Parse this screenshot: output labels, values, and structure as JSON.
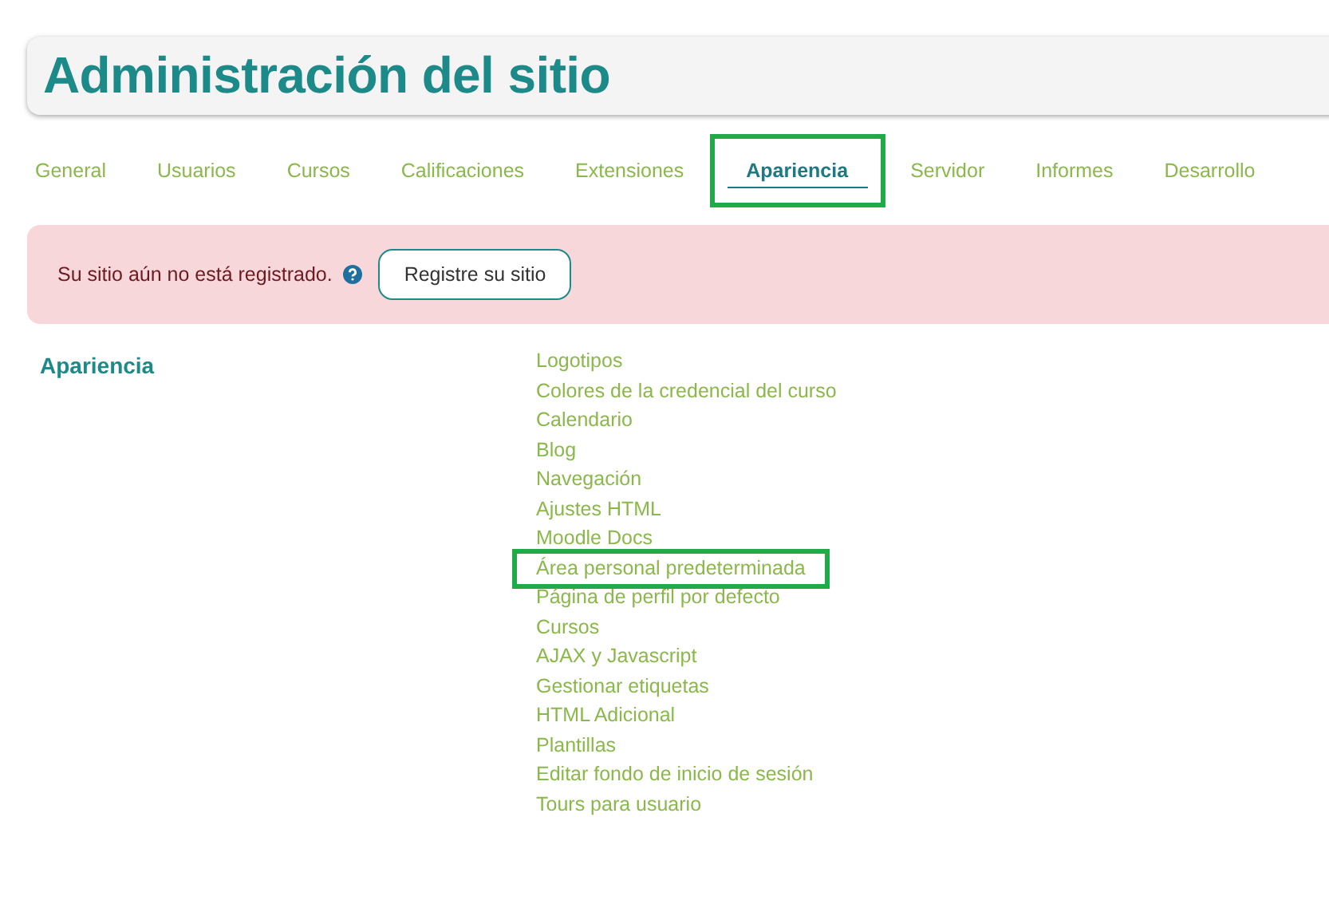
{
  "page_title": "Administración del sitio",
  "tabs": [
    {
      "label": "General",
      "selected": false,
      "highlighted": false
    },
    {
      "label": "Usuarios",
      "selected": false,
      "highlighted": false
    },
    {
      "label": "Cursos",
      "selected": false,
      "highlighted": false
    },
    {
      "label": "Calificaciones",
      "selected": false,
      "highlighted": false
    },
    {
      "label": "Extensiones",
      "selected": false,
      "highlighted": false
    },
    {
      "label": "Apariencia",
      "selected": true,
      "highlighted": true
    },
    {
      "label": "Servidor",
      "selected": false,
      "highlighted": false
    },
    {
      "label": "Informes",
      "selected": false,
      "highlighted": false
    },
    {
      "label": "Desarrollo",
      "selected": false,
      "highlighted": false
    }
  ],
  "alert": {
    "message": "Su sitio aún no está registrado.",
    "button": "Registre su sitio"
  },
  "section": {
    "heading": "Apariencia",
    "links": [
      {
        "label": "Logotipos",
        "highlighted": false
      },
      {
        "label": "Colores de la credencial del curso",
        "highlighted": false
      },
      {
        "label": "Calendario",
        "highlighted": false
      },
      {
        "label": "Blog",
        "highlighted": false
      },
      {
        "label": "Navegación",
        "highlighted": false
      },
      {
        "label": "Ajustes HTML",
        "highlighted": false
      },
      {
        "label": "Moodle Docs",
        "highlighted": false
      },
      {
        "label": "Área personal predeterminada",
        "highlighted": true
      },
      {
        "label": "Página de perfil por defecto",
        "highlighted": false
      },
      {
        "label": "Cursos",
        "highlighted": false
      },
      {
        "label": "AJAX y Javascript",
        "highlighted": false
      },
      {
        "label": "Gestionar etiquetas",
        "highlighted": false
      },
      {
        "label": "HTML Adicional",
        "highlighted": false
      },
      {
        "label": "Plantillas",
        "highlighted": false
      },
      {
        "label": "Editar fondo de inicio de sesión",
        "highlighted": false
      },
      {
        "label": "Tours para usuario",
        "highlighted": false
      }
    ]
  }
}
